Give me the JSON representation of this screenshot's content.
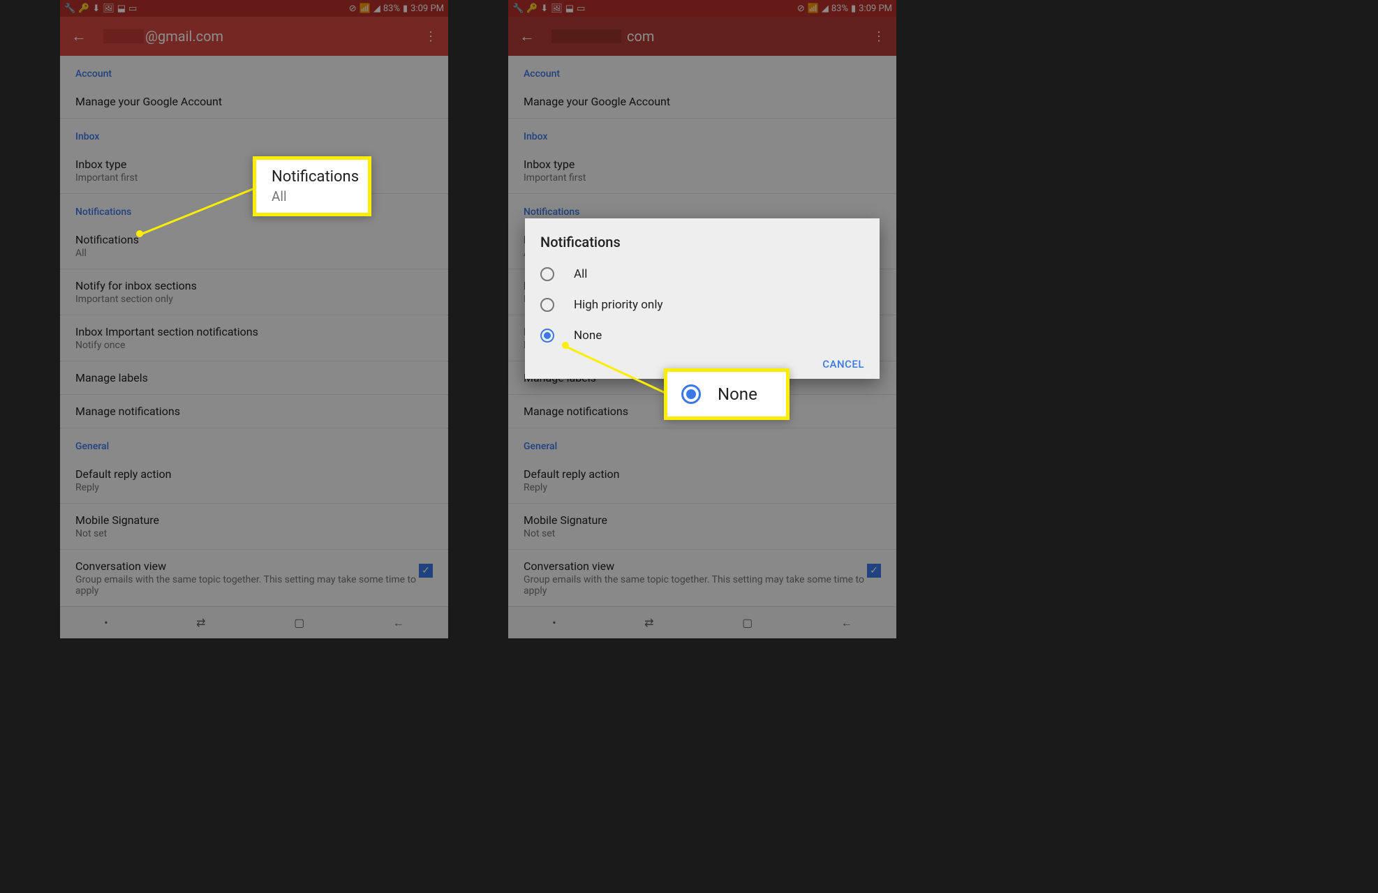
{
  "status": {
    "battery": "83%",
    "time": "3:09 PM"
  },
  "header": {
    "email_suffix_left": "@gmail.com",
    "email_suffix_right": "com"
  },
  "sections": {
    "account": "Account",
    "inbox": "Inbox",
    "notifications": "Notifications",
    "general": "General"
  },
  "items": {
    "manage_account": "Manage your Google Account",
    "inbox_type": {
      "title": "Inbox type",
      "sub": "Important first"
    },
    "notifications": {
      "title": "Notifications",
      "sub": "All"
    },
    "notify_sections": {
      "title": "Notify for inbox sections",
      "sub": "Important section only"
    },
    "important_notif": {
      "title": "Inbox Important section notifications",
      "sub": "Notify once"
    },
    "manage_labels": "Manage labels",
    "manage_notifications": "Manage notifications",
    "default_reply": {
      "title": "Default reply action",
      "sub": "Reply"
    },
    "mobile_sig": {
      "title": "Mobile Signature",
      "sub": "Not set"
    },
    "conversation": {
      "title": "Conversation view",
      "sub": "Group emails with the same topic together. This setting may take some time to apply"
    }
  },
  "dialog": {
    "title": "Notifications",
    "options": {
      "all": "All",
      "high": "High priority only",
      "none": "None"
    },
    "cancel": "CANCEL"
  },
  "callout1": {
    "title": "Notifications",
    "sub": "All"
  },
  "callout2": {
    "label": "None"
  }
}
